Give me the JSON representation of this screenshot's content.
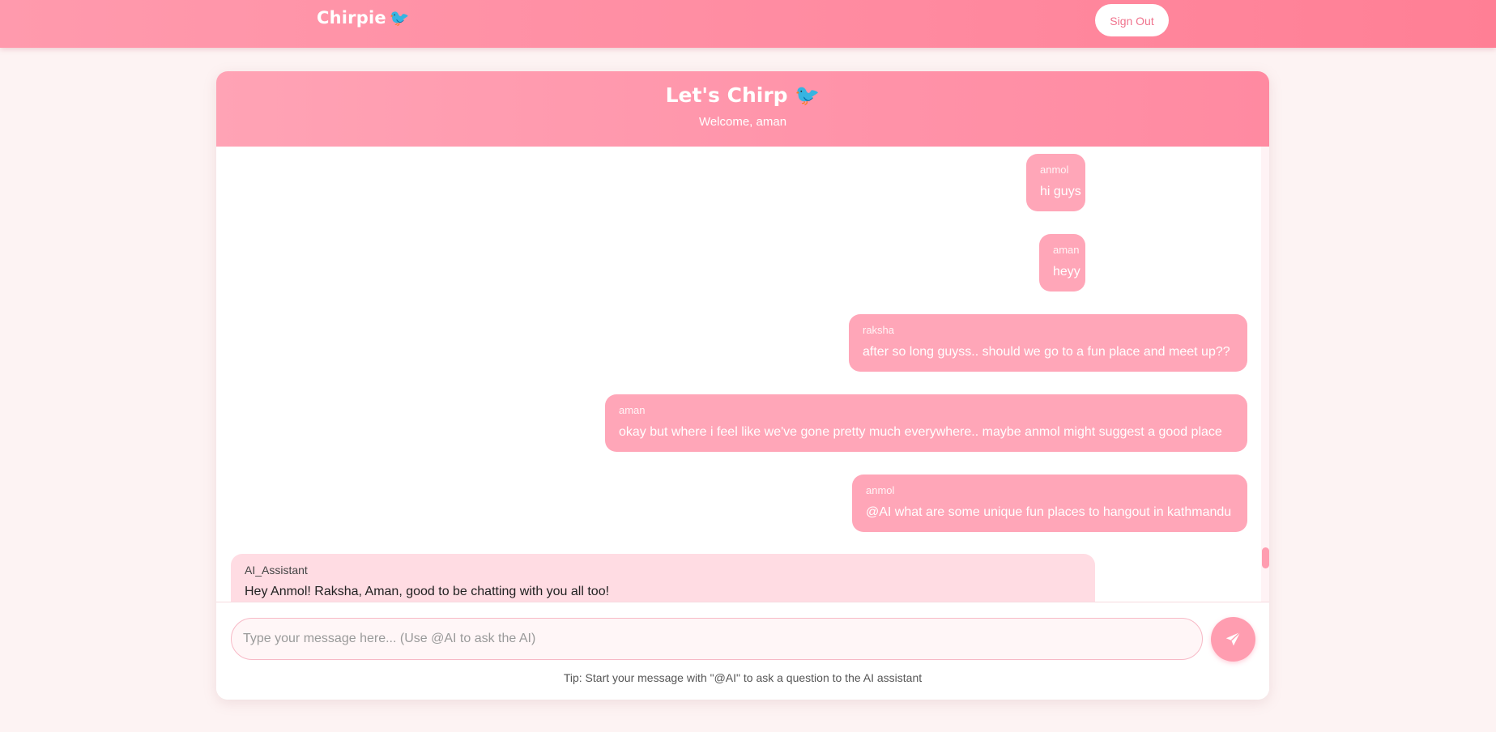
{
  "app": {
    "brand": "Chirpie",
    "brand_icon": "bird-icon",
    "signout_label": "Sign Out"
  },
  "chat": {
    "title": "Let's Chirp",
    "title_icon": "bird-icon",
    "welcome": "Welcome, aman",
    "messages": [
      {
        "sender": "anmol",
        "text": "hi guys"
      },
      {
        "sender": "aman",
        "text": "heyy"
      },
      {
        "sender": "raksha",
        "text": "after so long guyss.. should we go to a fun place and meet up??"
      },
      {
        "sender": "aman",
        "text": "okay but where i feel like we've gone pretty much everywhere.. maybe anmol might suggest a good place"
      },
      {
        "sender": "anmol",
        "text": "@AI what are some unique fun places to hangout in kathmandu"
      },
      {
        "sender": "AI_Assistant",
        "text": "Hey Anmol! Raksha, Aman, good to be chatting with you all too!"
      }
    ]
  },
  "composer": {
    "placeholder": "Type your message here... (Use @AI to ask the AI)",
    "value": "",
    "send_icon": "paper-plane-icon",
    "tip": "Tip: Start your message with \"@AI\" to ask a question to the AI assistant"
  },
  "colors": {
    "accent": "#ff8aa0",
    "bubble": "#ffa6b8",
    "ai_bubble": "#ffdce3",
    "background": "#fdf3f3"
  }
}
